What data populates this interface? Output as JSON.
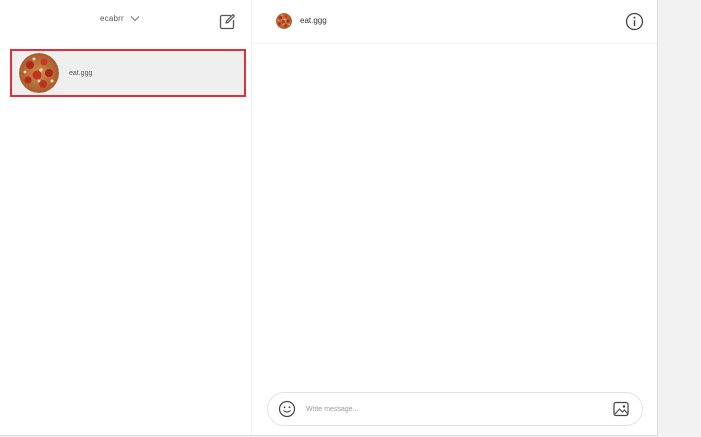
{
  "sidebar": {
    "account_name": "ecabrr",
    "account_chevron_icon": "chevron-down-icon",
    "compose_icon": "new-message-icon",
    "threads": [
      {
        "name": "eat.ggg",
        "avatar": "pizza-avatar",
        "selected": true
      }
    ]
  },
  "chat": {
    "title": "eat.ggg",
    "avatar": "pizza-avatar",
    "info_icon": "info-icon",
    "composer": {
      "placeholder": "Write message...",
      "value": "",
      "emoji_icon": "emoji-icon",
      "image_icon": "image-icon"
    }
  },
  "colors": {
    "selection_outline": "#e0303a",
    "selected_row_bg": "#efefef"
  }
}
